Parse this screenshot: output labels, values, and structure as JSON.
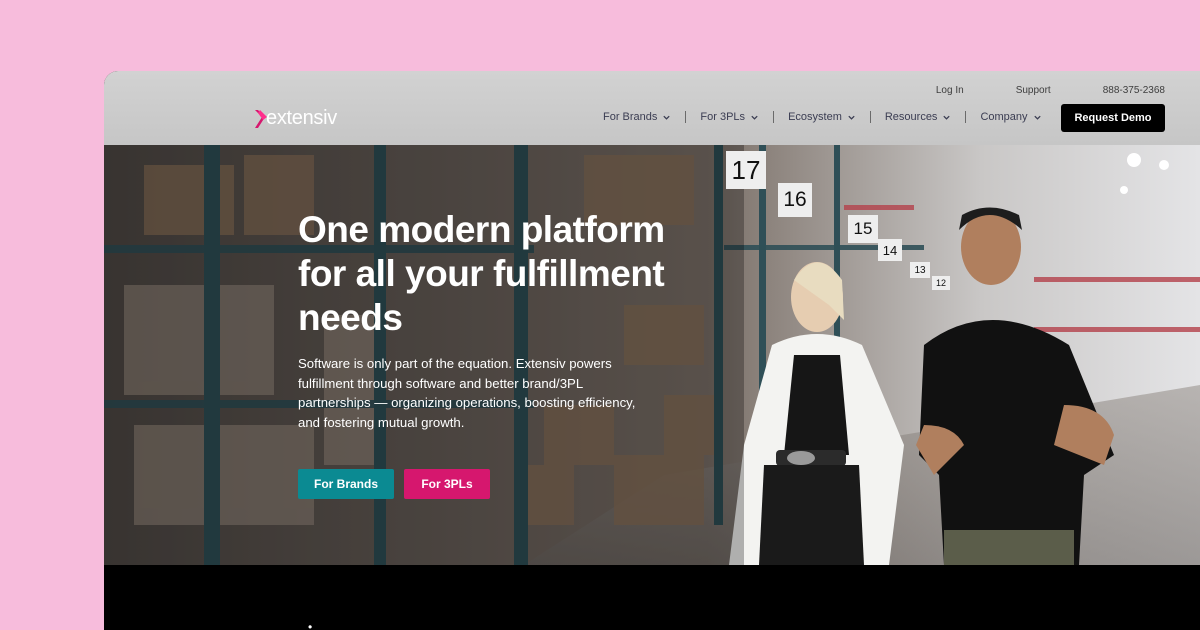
{
  "header": {
    "utility_links": [
      "Log In",
      "Support",
      "888-375-2368"
    ],
    "logo_text": "extensiv",
    "nav": [
      "For Brands",
      "For 3PLs",
      "Ecosystem",
      "Resources",
      "Company"
    ],
    "cta": "Request Demo"
  },
  "hero": {
    "title_lines": [
      "One modern platform",
      "for all your fulfillment",
      "needs"
    ],
    "subtitle": "Software is only part of the equation. Extensiv powers fulfillment through software and better brand/3PL partnerships — organizing operations, boosting efficiency, and fostering mutual growth.",
    "buttons": {
      "brands": "For Brands",
      "tpl": "For 3PLs"
    },
    "shelf_numbers": [
      "17",
      "16",
      "15",
      "14",
      "13",
      "12"
    ]
  },
  "colors": {
    "page_bg": "#f7bcdc",
    "brand_magenta": "#d6176e",
    "brand_teal": "#0b8a92",
    "header_bg": "#cbcbcb"
  }
}
